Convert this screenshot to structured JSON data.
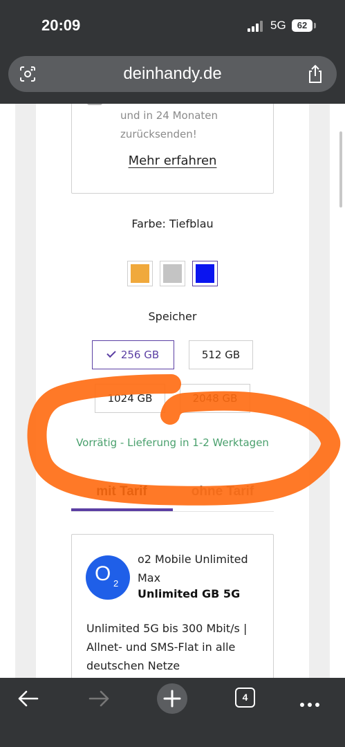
{
  "status_bar": {
    "time": "20:09",
    "network": "5G",
    "battery": "62"
  },
  "browser": {
    "url": "deinhandy.de",
    "tab_count": "4"
  },
  "info_box": {
    "line1": "und in 24 Monaten",
    "line2": "zurücksenden!",
    "link": "Mehr erfahren"
  },
  "color_selector": {
    "label": "Farbe: Tiefblau",
    "swatches": [
      {
        "name": "orange",
        "color": "#f0a93c"
      },
      {
        "name": "silber",
        "color": "#c4c4c4"
      },
      {
        "name": "tiefblau",
        "color": "#0a14f0",
        "selected": true
      }
    ]
  },
  "storage_selector": {
    "label": "Speicher",
    "options": [
      "256 GB",
      "512 GB",
      "1024 GB",
      "2048 GB"
    ],
    "selected": "256 GB"
  },
  "availability": "Vorrätig - Lieferung in 1-2 Werktagen",
  "tabs": [
    "mit Tarif",
    "ohne Tarif"
  ],
  "offer": {
    "logo_letter": "O",
    "logo_sub": "2",
    "name_line1": "o2 Mobile Unlimited",
    "name_line2": "Max",
    "data": "Unlimited GB 5G",
    "desc_line1": "Unlimited 5G bis 300 Mbit/s |",
    "desc_line2": "Allnet- und SMS-Flat in alle",
    "desc_line3": "deutschen Netze"
  },
  "colors": {
    "accent": "#5b3fa3",
    "stock_green": "#4aa06d",
    "annotation_orange": "#ff6a10",
    "o2_blue": "#1f5fe8"
  }
}
